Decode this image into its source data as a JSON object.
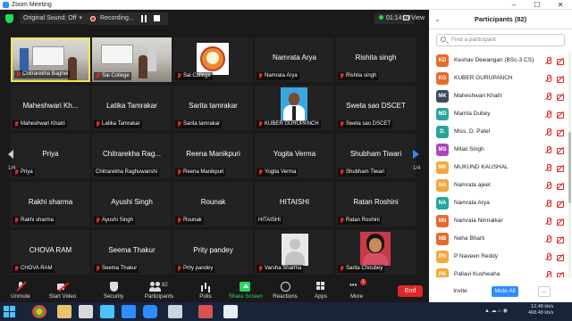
{
  "window": {
    "title": "Zoom Meeting",
    "controls": [
      "–",
      "☐",
      "✕"
    ]
  },
  "topbar": {
    "original_sound": "Original Sound: Off",
    "recording": "Recording...",
    "timer": "01:14:09",
    "view": "View"
  },
  "tiles": [
    {
      "caption": "Chitrarekha Baghel",
      "center": ""
    },
    {
      "caption": "Sai College",
      "center": ""
    },
    {
      "caption": "Sai College",
      "center": ""
    },
    {
      "caption": "Namrata Arya",
      "center": "Namrata Arya"
    },
    {
      "caption": "Rishita singh",
      "center": "Rishita singh"
    },
    {
      "caption": "Maheshwari Khatri",
      "center": "Maheshwari  Kh..."
    },
    {
      "caption": "Latika Tamrakar",
      "center": "Latika Tamrakar"
    },
    {
      "caption": "Sarita tamrakar",
      "center": "Sarita tamrakar"
    },
    {
      "caption": "KUBER GURUPANCH",
      "center": ""
    },
    {
      "caption": "Sweta sao DSCET",
      "center": "Sweta sao DSCET"
    },
    {
      "caption": "Priya",
      "center": "Priya"
    },
    {
      "caption": "Chitrarekha Raghuwanshi",
      "center": "Chitrarekha  Rag..."
    },
    {
      "caption": "Reena Manikpuri",
      "center": "Reena Manikpuri"
    },
    {
      "caption": "Yogita Verma",
      "center": "Yogita Verma"
    },
    {
      "caption": "Shubham Tiwari",
      "center": "Shubham Tiwari"
    },
    {
      "caption": "Rakhi sharma",
      "center": "Rakhi sharma"
    },
    {
      "caption": "Ayushi Singh",
      "center": "Ayushi Singh"
    },
    {
      "caption": "Rounak",
      "center": "Rounak"
    },
    {
      "caption": "HITAISHI",
      "center": "HITAISHI"
    },
    {
      "caption": "Ratan Roshini",
      "center": "Ratan Roshini"
    },
    {
      "caption": "CHOVA RAM",
      "center": "CHOVA RAM"
    },
    {
      "caption": "Seema Thakur",
      "center": "Seema Thakur"
    },
    {
      "caption": "Prity pandey",
      "center": "Prity pandey"
    },
    {
      "caption": "Varsha Sharma",
      "center": ""
    },
    {
      "caption": "Sarita Choubey",
      "center": ""
    }
  ],
  "paging": {
    "left": "1/4",
    "right": "1/4"
  },
  "toolbar": {
    "unmute": "Unmute",
    "start_video": "Start Video",
    "security": "Security",
    "participants": "Participants",
    "participants_count": "82",
    "polls": "Polls",
    "share_screen": "Share Screen",
    "reactions": "Reactions",
    "apps": "Apps",
    "more": "More",
    "more_badge": "1",
    "end": "End"
  },
  "panel": {
    "title": "Participants (82)",
    "search_placeholder": "Find a participant",
    "participants": [
      {
        "initials": "KD",
        "name": "Keshav Dewangan (BSc-3 CS)",
        "color": "#e8692a"
      },
      {
        "initials": "KG",
        "name": "KUBER GURUPANCH",
        "color": "#e8692a"
      },
      {
        "initials": "MK",
        "name": "Maheshwari Khatri",
        "color": "#3d4a5c"
      },
      {
        "initials": "MD",
        "name": "Mamta Dubey",
        "color": "#26a69a"
      },
      {
        "initials": "D.",
        "name": "Miss. D. Patel",
        "color": "#26a69a"
      },
      {
        "initials": "MS",
        "name": "Mitali Singh",
        "color": "#ab47bc"
      },
      {
        "initials": "MK",
        "name": "MUKUND KAUSHAL",
        "color": "#f2a93b"
      },
      {
        "initials": "NA",
        "name": "Namrata ajeet",
        "color": "#f2a93b"
      },
      {
        "initials": "NA",
        "name": "Namrata Arya",
        "color": "#26a69a"
      },
      {
        "initials": "NN",
        "name": "Namrata Nirmalkar",
        "color": "#e8692a"
      },
      {
        "initials": "NB",
        "name": "Neha Bharti",
        "color": "#e8692a"
      },
      {
        "initials": "PN",
        "name": "P Naveen Reddy",
        "color": "#f2a93b"
      },
      {
        "initials": "PK",
        "name": "Pallavi Kushwaha",
        "color": "#f2a93b"
      }
    ],
    "invite": "Invite",
    "mute_all": "Mute All",
    "more": "..."
  },
  "taskbar": {
    "tray_time": "",
    "speed_up": "12.48 kb/s",
    "speed_down": "468.48 kb/s"
  }
}
